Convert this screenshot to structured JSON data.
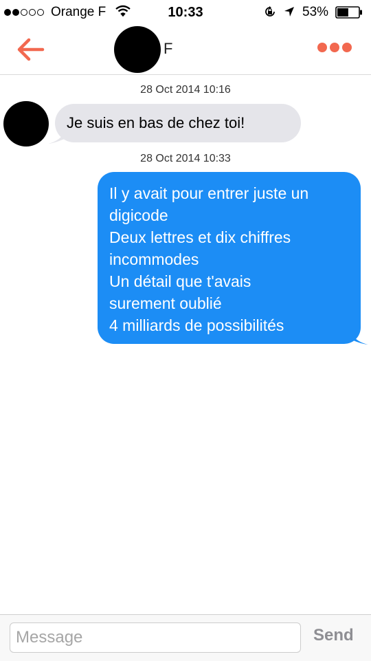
{
  "status_bar": {
    "carrier": "Orange F",
    "time": "10:33",
    "battery": "53%",
    "signal_bars_filled": 2,
    "signal_bars_total": 5,
    "battery_level": 0.53,
    "icons": [
      "wifi-icon",
      "orientation-lock-icon",
      "location-arrow-icon",
      "battery-icon"
    ]
  },
  "nav": {
    "contact_name": "F",
    "back_icon": "back-arrow-icon",
    "more_icon": "more-dots-icon",
    "accent_color": "#f2684f"
  },
  "thread": {
    "messages": [
      {
        "timestamp": "28 Oct 2014 10:16",
        "direction": "incoming",
        "lines": [
          "Je suis en bas de chez toi!"
        ]
      },
      {
        "timestamp": "28 Oct 2014 10:33",
        "direction": "outgoing",
        "lines": [
          "Il y avait pour entrer juste un",
          "digicode",
          "Deux lettres et dix chiffres",
          "incommodes",
          "Un détail que t'avais",
          "surement oublié",
          "4 milliards de possibilités"
        ]
      }
    ],
    "outgoing_color": "#1c8df5",
    "incoming_color": "#e5e5ea"
  },
  "composer": {
    "placeholder": "Message",
    "value": "",
    "send_label": "Send"
  }
}
